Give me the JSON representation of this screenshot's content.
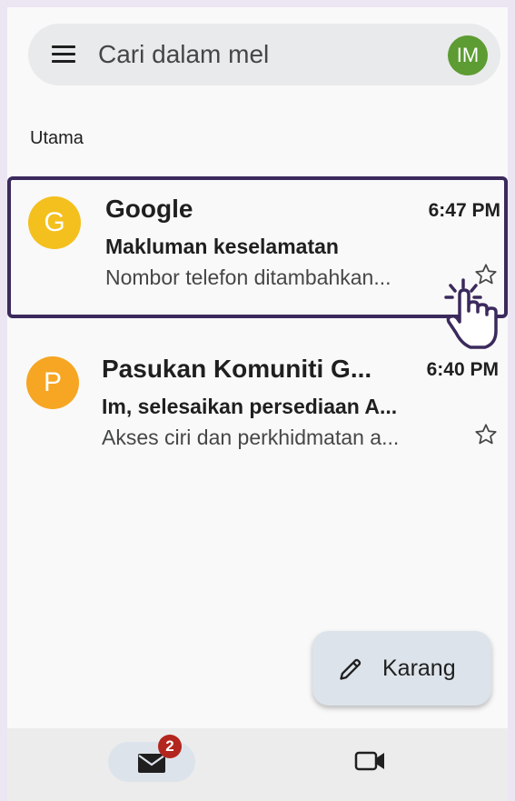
{
  "search": {
    "placeholder": "Cari dalam mel",
    "menu_icon": "menu-icon",
    "account_avatar": {
      "initials": "IM",
      "color": "#5c9c33"
    }
  },
  "inbox": {
    "section_label": "Utama",
    "emails": [
      {
        "avatar_letter": "G",
        "avatar_color": "#f4c01e",
        "sender": "Google",
        "time": "6:47 PM",
        "subject": "Makluman keselamatan",
        "snippet": "Nombor telefon ditambahkan...",
        "starred": false,
        "selected": true
      },
      {
        "avatar_letter": "P",
        "avatar_color": "#f6a623",
        "sender": "Pasukan Komuniti G...",
        "time": "6:40 PM",
        "subject": "Im, selesaikan persediaan A...",
        "snippet": "Akses ciri dan perkhidmatan a...",
        "starred": false,
        "selected": false
      }
    ]
  },
  "compose": {
    "label": "Karang",
    "icon": "pencil-icon"
  },
  "bottom_nav": {
    "mail": {
      "icon": "mail-icon",
      "badge": "2",
      "active": true
    },
    "meet": {
      "icon": "video-icon",
      "active": false
    }
  },
  "colors": {
    "accent_border": "#3b2a5c",
    "badge": "#b3261e",
    "fab_bg": "#dde3ea"
  }
}
